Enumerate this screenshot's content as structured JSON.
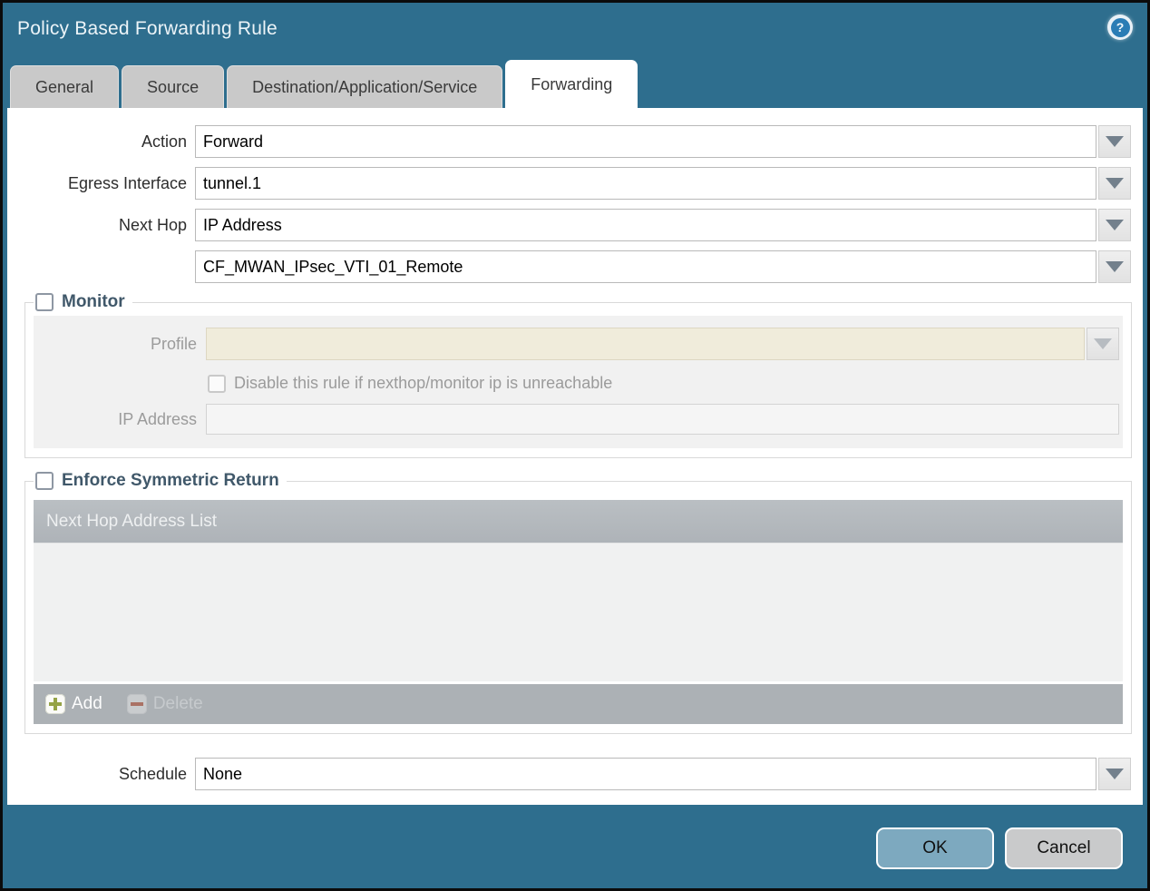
{
  "dialog": {
    "title": "Policy Based Forwarding Rule",
    "help_glyph": "?"
  },
  "tabs": [
    {
      "label": "General",
      "active": false
    },
    {
      "label": "Source",
      "active": false
    },
    {
      "label": "Destination/Application/Service",
      "active": false
    },
    {
      "label": "Forwarding",
      "active": true
    }
  ],
  "form": {
    "action": {
      "label": "Action",
      "value": "Forward"
    },
    "egress_interface": {
      "label": "Egress Interface",
      "value": "tunnel.1"
    },
    "next_hop": {
      "label": "Next Hop",
      "value": "IP Address"
    },
    "next_hop_address": {
      "value": "CF_MWAN_IPsec_VTI_01_Remote"
    },
    "schedule": {
      "label": "Schedule",
      "value": "None"
    }
  },
  "monitor": {
    "legend": "Monitor",
    "checked": false,
    "profile": {
      "label": "Profile",
      "value": ""
    },
    "disable_rule": {
      "label": "Disable this rule if nexthop/monitor ip is unreachable",
      "checked": false
    },
    "ip_address": {
      "label": "IP Address",
      "value": ""
    }
  },
  "enforce_symmetric_return": {
    "legend": "Enforce Symmetric Return",
    "checked": false,
    "table": {
      "header": "Next Hop Address List",
      "rows": [],
      "add_label": "Add",
      "delete_label": "Delete"
    }
  },
  "footer": {
    "ok_label": "OK",
    "cancel_label": "Cancel"
  },
  "colors": {
    "titlebar": "#2e6e8e",
    "inactive_tab": "#c9c9c9",
    "legend_text": "#40586a",
    "profile_field": "#f0ecdb",
    "grid_header": "#b3b8bc",
    "grid_footer": "#acb1b5",
    "add_plus": "#95a346",
    "delete_minus": "#aa7265",
    "ok_button": "#7da9bf",
    "cancel_button": "#c9cacb"
  }
}
